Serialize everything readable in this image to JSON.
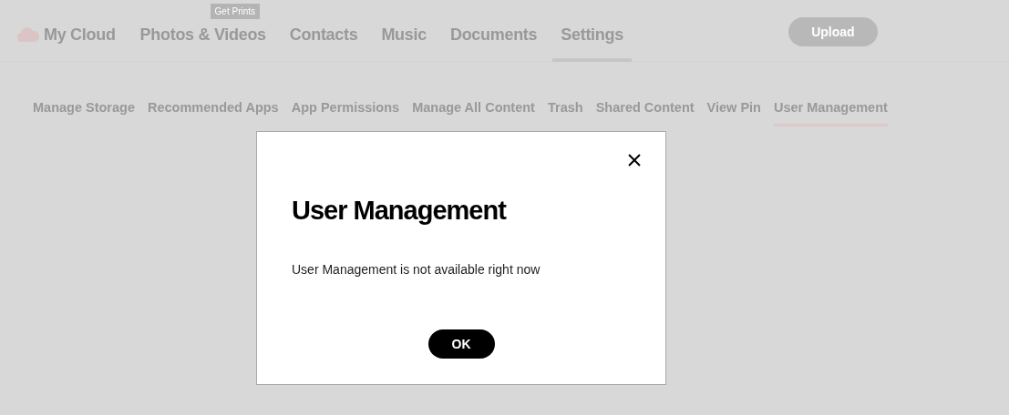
{
  "header": {
    "logo": "My Cloud",
    "nav": [
      {
        "label": "Photos & Videos",
        "selected": false,
        "badge": "Get Prints"
      },
      {
        "label": "Contacts",
        "selected": false
      },
      {
        "label": "Music",
        "selected": false
      },
      {
        "label": "Documents",
        "selected": false
      },
      {
        "label": "Settings",
        "selected": true
      }
    ],
    "upload": "Upload"
  },
  "subnav": [
    {
      "label": "Manage Storage",
      "selected": false
    },
    {
      "label": "Recommended Apps",
      "selected": false
    },
    {
      "label": "App Permissions",
      "selected": false
    },
    {
      "label": "Manage All Content",
      "selected": false
    },
    {
      "label": "Trash",
      "selected": false
    },
    {
      "label": "Shared Content",
      "selected": false
    },
    {
      "label": "View Pin",
      "selected": false
    },
    {
      "label": "User Management",
      "selected": true
    }
  ],
  "dialog": {
    "title": "User Management",
    "message": "User Management is not available right now",
    "button": "OK"
  }
}
